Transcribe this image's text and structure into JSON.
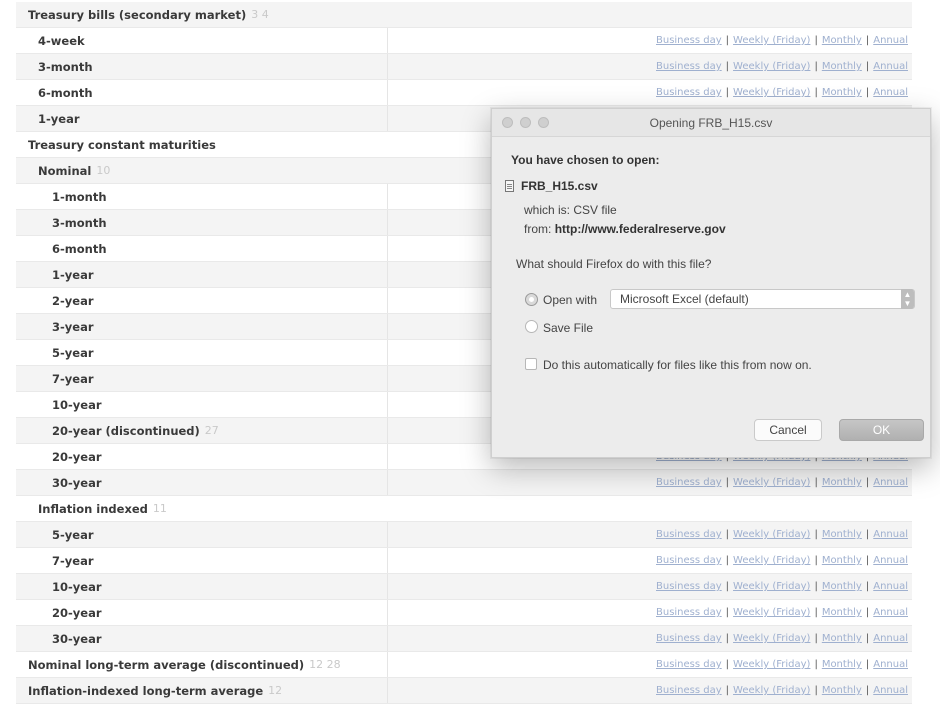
{
  "link_labels": {
    "business_day": "Business day",
    "weekly": "Weekly (Friday)",
    "monthly": "Monthly",
    "annual": "Annual",
    "separator": "|"
  },
  "table_rows": [
    {
      "label": "Treasury bills (secondary market)",
      "footnotes": "3 4",
      "level": 0,
      "links": false
    },
    {
      "label": "4-week",
      "footnotes": "",
      "level": 1,
      "links": true
    },
    {
      "label": "3-month",
      "footnotes": "",
      "level": 1,
      "links": true
    },
    {
      "label": "6-month",
      "footnotes": "",
      "level": 1,
      "links": true
    },
    {
      "label": "1-year",
      "footnotes": "",
      "level": 1,
      "links": true
    },
    {
      "label": "Treasury constant maturities",
      "footnotes": "",
      "level": 0,
      "links": false
    },
    {
      "label": "Nominal",
      "footnotes": "10",
      "level": 1,
      "links": false
    },
    {
      "label": "1-month",
      "footnotes": "",
      "level": 2,
      "links": true
    },
    {
      "label": "3-month",
      "footnotes": "",
      "level": 2,
      "links": true
    },
    {
      "label": "6-month",
      "footnotes": "",
      "level": 2,
      "links": true
    },
    {
      "label": "1-year",
      "footnotes": "",
      "level": 2,
      "links": true
    },
    {
      "label": "2-year",
      "footnotes": "",
      "level": 2,
      "links": true
    },
    {
      "label": "3-year",
      "footnotes": "",
      "level": 2,
      "links": true
    },
    {
      "label": "5-year",
      "footnotes": "",
      "level": 2,
      "links": true
    },
    {
      "label": "7-year",
      "footnotes": "",
      "level": 2,
      "links": true
    },
    {
      "label": "10-year",
      "footnotes": "",
      "level": 2,
      "links": true
    },
    {
      "label": "20-year (discontinued)",
      "footnotes": "27",
      "level": 2,
      "links": true
    },
    {
      "label": "20-year",
      "footnotes": "",
      "level": 2,
      "links": true
    },
    {
      "label": "30-year",
      "footnotes": "",
      "level": 2,
      "links": true
    },
    {
      "label": "Inflation indexed",
      "footnotes": "11",
      "level": 1,
      "links": false
    },
    {
      "label": "5-year",
      "footnotes": "",
      "level": 2,
      "links": true
    },
    {
      "label": "7-year",
      "footnotes": "",
      "level": 2,
      "links": true
    },
    {
      "label": "10-year",
      "footnotes": "",
      "level": 2,
      "links": true
    },
    {
      "label": "20-year",
      "footnotes": "",
      "level": 2,
      "links": true
    },
    {
      "label": "30-year",
      "footnotes": "",
      "level": 2,
      "links": true
    },
    {
      "label": "Nominal long-term average (discontinued)",
      "footnotes": "12 28",
      "level": 0,
      "links": true
    },
    {
      "label": "Inflation-indexed long-term average",
      "footnotes": "12",
      "level": 0,
      "links": true
    }
  ],
  "dialog": {
    "title": "Opening FRB_H15.csv",
    "heading": "You have chosen to open:",
    "file_name": "FRB_H15.csv",
    "which_is_label": "which is:",
    "which_is_value": "CSV file",
    "from_label": "from:",
    "from_value": "http://www.federalreserve.gov",
    "question": "What should Firefox do with this file?",
    "open_with_label": "Open with",
    "open_with_app": "Microsoft Excel (default)",
    "save_file_label": "Save File",
    "auto_label": "Do this automatically for files like this from now on.",
    "cancel_label": "Cancel",
    "ok_label": "OK",
    "selected_option": "open_with",
    "auto_checked": false
  },
  "colors": {
    "link": "#9fb0cf",
    "row_alt": "#f4f4f4",
    "dialog_bg": "#ececec",
    "ok_button": "#bababa"
  },
  "icons": {
    "file": "csv-file-icon",
    "select_stepper": "select-stepper-icon"
  }
}
